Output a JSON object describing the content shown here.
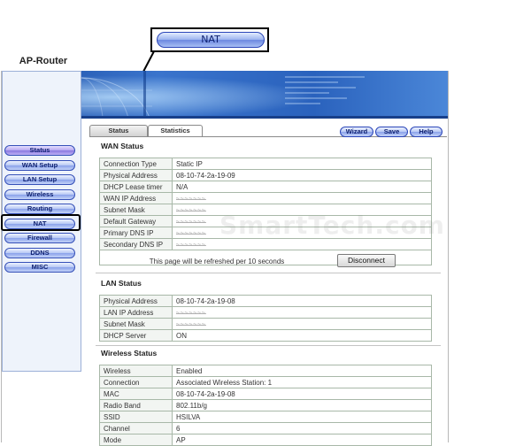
{
  "callout": {
    "label": "NAT"
  },
  "app": {
    "title": "AP-Router"
  },
  "nav": {
    "items": [
      {
        "label": "Status",
        "active": true
      },
      {
        "label": "WAN Setup"
      },
      {
        "label": "LAN Setup"
      },
      {
        "label": "Wireless"
      },
      {
        "label": "Routing"
      },
      {
        "label": "NAT",
        "highlighted": true
      },
      {
        "label": "Firewall"
      },
      {
        "label": "DDNS"
      },
      {
        "label": "MISC"
      }
    ]
  },
  "tabs": [
    {
      "label": "Status"
    },
    {
      "label": "Statistics",
      "active": true
    }
  ],
  "toolbar": {
    "wizard": "Wizard",
    "save": "Save",
    "help": "Help"
  },
  "wan": {
    "title": "WAN Status",
    "rows": [
      {
        "label": "Connection Type",
        "value": "Static IP"
      },
      {
        "label": "Physical Address",
        "value": "08-10-74-2a-19-09"
      },
      {
        "label": "DHCP Lease timer",
        "value": "N/A"
      },
      {
        "label": "WAN IP Address",
        "value": "",
        "redacted": true
      },
      {
        "label": "Subnet Mask",
        "value": "",
        "redacted": true
      },
      {
        "label": "Default Gateway",
        "value": "",
        "redacted": true
      },
      {
        "label": "Primary DNS IP",
        "value": "",
        "redacted": true
      },
      {
        "label": "Secondary DNS IP",
        "value": "",
        "redacted": true
      }
    ],
    "refresh_note": "This page will be refreshed per 10 seconds",
    "disconnect_label": "Disconnect"
  },
  "lan": {
    "title": "LAN Status",
    "rows": [
      {
        "label": "Physical Address",
        "value": "08-10-74-2a-19-08"
      },
      {
        "label": "LAN IP Address",
        "value": "",
        "redacted": true
      },
      {
        "label": "Subnet Mask",
        "value": "",
        "redacted": true
      },
      {
        "label": "DHCP Server",
        "value": "ON"
      }
    ]
  },
  "wireless": {
    "title": "Wireless Status",
    "rows": [
      {
        "label": "Wireless",
        "value": "Enabled"
      },
      {
        "label": "Connection",
        "value": "Associated Wireless Station: 1"
      },
      {
        "label": "MAC",
        "value": "08-10-74-2a-19-08"
      },
      {
        "label": "Radio Band",
        "value": "802.11b/g"
      },
      {
        "label": "SSID",
        "value": "HSILVA"
      },
      {
        "label": "Channel",
        "value": "6"
      },
      {
        "label": "Mode",
        "value": "AP"
      }
    ]
  },
  "watermark": "SmartTech.com",
  "colors": {
    "button_blue": "#8aa2ea",
    "active_purple": "#8b78e0",
    "banner_blue": "#2a5fb8"
  }
}
